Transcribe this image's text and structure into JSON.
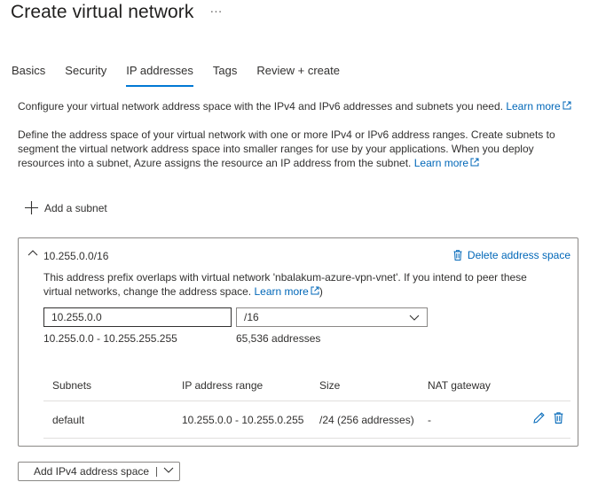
{
  "header": {
    "title": "Create virtual network",
    "more_label": "···"
  },
  "tabs": [
    {
      "label": "Basics",
      "active": false
    },
    {
      "label": "Security",
      "active": false
    },
    {
      "label": "IP addresses",
      "active": true
    },
    {
      "label": "Tags",
      "active": false
    },
    {
      "label": "Review + create",
      "active": false
    }
  ],
  "intro": {
    "text": "Configure your virtual network address space with the IPv4 and IPv6 addresses and subnets you need.",
    "learn_more": "Learn more"
  },
  "description": {
    "text": "Define the address space of your virtual network with one or more IPv4 or IPv6 address ranges. Create subnets to segment the virtual network address space into smaller ranges for use by your applications. When you deploy resources into a subnet, Azure assigns the resource an IP address from the subnet.",
    "learn_more": "Learn more"
  },
  "add_subnet_label": "Add a subnet",
  "address_space": {
    "title": "10.255.0.0/16",
    "delete_label": "Delete address space",
    "warning": "This address prefix overlaps with virtual network 'nbalakum-azure-vpn-vnet'. If you intend to peer these virtual networks, change the address space.",
    "warning_learn_more": "Learn more",
    "warning_close": ")",
    "address_value": "10.255.0.0",
    "prefix_value": "/16",
    "range": "10.255.0.0 - 10.255.255.255",
    "count": "65,536 addresses"
  },
  "subnets_table": {
    "headers": [
      "Subnets",
      "IP address range",
      "Size",
      "NAT gateway"
    ],
    "rows": [
      {
        "name": "default",
        "range": "10.255.0.0 - 10.255.0.255",
        "size": "/24 (256 addresses)",
        "nat": "-"
      }
    ]
  },
  "add_ipv4_label": "Add IPv4 address space",
  "colors": {
    "accent": "#0078d4",
    "link": "#0067b8",
    "text": "#323130",
    "border": "#8a8886"
  }
}
